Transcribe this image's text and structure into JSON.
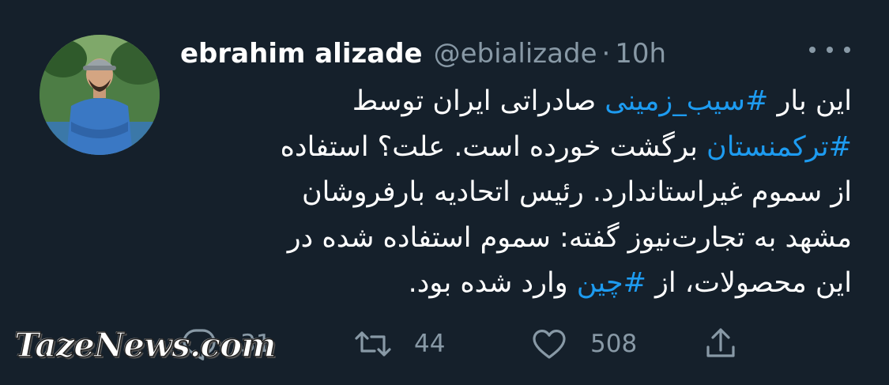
{
  "tweet": {
    "author_name": "ebrahim alizade",
    "author_handle": "@ebializade",
    "separator": "·",
    "time": "10h",
    "lines": [
      {
        "before": "این بار ",
        "tag": "#سیب_زمینی",
        "after": " صادراتی ایران توسط"
      },
      {
        "before": "",
        "tag": "#ترکمنستان",
        "after": " برگشت خورده است. علت؟ استفاده"
      },
      {
        "before": "از سموم غیراستاندارد. رئیس اتحادیه بارفروشان",
        "tag": "",
        "after": ""
      },
      {
        "before": "مشهد به تجارت‌نیوز گفته: سموم استفاده شده در",
        "tag": "",
        "after": ""
      },
      {
        "before": "این محصولات، از ",
        "tag": "#چین",
        "after": " وارد شده بود."
      }
    ],
    "actions": {
      "replies": "31",
      "retweets": "44",
      "likes": "508"
    }
  },
  "icons": {
    "reply": "reply-icon",
    "retweet": "retweet-icon",
    "like": "heart-icon",
    "share": "share-icon",
    "more": "more-icon"
  },
  "colors": {
    "background": "#15202b",
    "text": "#ffffff",
    "secondary": "#8899a6",
    "accent": "#1d9bf0"
  },
  "watermark": "TazeNews.com"
}
